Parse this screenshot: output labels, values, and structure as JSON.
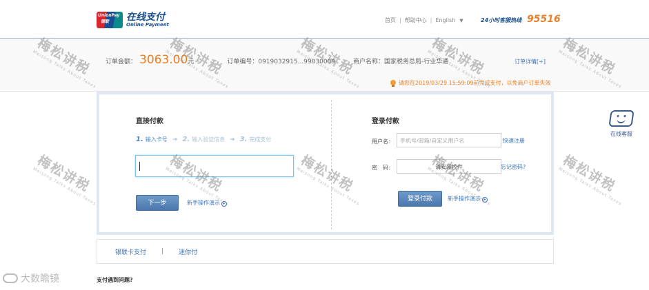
{
  "header": {
    "logo_badge_top": "UnionPay",
    "logo_badge_bottom": "银联",
    "logo_cn": "在线支付",
    "logo_en": "Online Payment",
    "nav_home": "首页",
    "nav_help": "帮助中心",
    "nav_lang": "English",
    "hotline_label": "24小时客服热线",
    "hotline_number": "95516"
  },
  "order": {
    "amount_label": "订单金额：",
    "amount": "3063.00",
    "amount_unit": "元",
    "order_no": "订单编号：0919032915...99030009",
    "merchant": "商户名称：国家税务总局-行业华通",
    "detail_link": "订单详情[+]",
    "notice": "请您在2019/03/29 15:59:09前完成支付，以免商户订单失效"
  },
  "direct": {
    "title": "直接付款",
    "steps": [
      {
        "num": "1.",
        "label": "输入卡号"
      },
      {
        "num": "2.",
        "label": "输入验证信息"
      },
      {
        "num": "3.",
        "label": "完成支付"
      }
    ],
    "next_button": "下一步",
    "help_link": "新手操作演示"
  },
  "login": {
    "title": "登录付款",
    "username_label": "用户名:",
    "username_placeholder": "手机号/邮箱/自定义用户名",
    "register_link": "快速注册",
    "password_label": "密　码:",
    "password_placeholder": "请安装控件",
    "forgot_link": "忘记密码?",
    "login_button": "登录付款",
    "help_link": "新手操作演示"
  },
  "tabs": [
    "银联卡支付",
    "迷你付"
  ],
  "tab_separator": "|",
  "problem": "支付遇到问题?",
  "service": {
    "label": "在线客服"
  },
  "watermark": {
    "cn": "梅松讲税",
    "en": "Meisong Talks About Taxes"
  },
  "brand_mark": "大数瞻镜"
}
